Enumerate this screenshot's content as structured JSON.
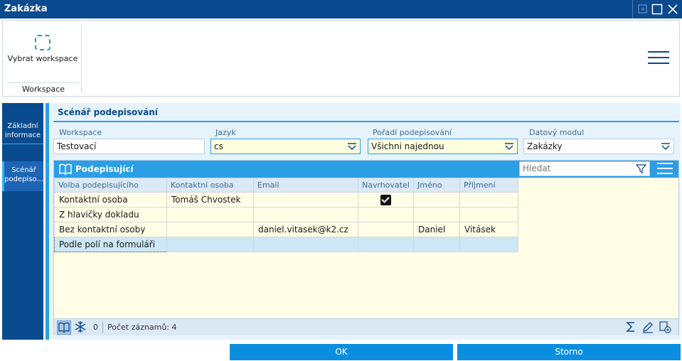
{
  "window": {
    "title": "Zakázka"
  },
  "ribbon": {
    "select_workspace_label": "Vybrat workspace",
    "group_label": "Workspace"
  },
  "left_tabs": [
    {
      "line1": "Základní",
      "line2": "informace"
    },
    {
      "line1": "Scénář",
      "line2": "podepiso..."
    }
  ],
  "section": {
    "title": "Scénář podepisování"
  },
  "fields": {
    "workspace": {
      "label": "Workspace",
      "value": "Testovací"
    },
    "jazyk": {
      "label": "Jazyk",
      "value": "cs"
    },
    "poradi": {
      "label": "Pořadí podepisování",
      "value": "Všichni najednou"
    },
    "datovy_modul": {
      "label": "Datový modul",
      "value": "Zakázky"
    }
  },
  "grid": {
    "title": "Podepisující",
    "search_placeholder": "Hledat",
    "columns": [
      "Volba podepisujícího",
      "Kontaktní osoba",
      "Email",
      "Navrhovatel",
      "Jméno",
      "Příjmení"
    ],
    "rows": [
      {
        "volba": "Kontaktní osoba",
        "kontakt": "Tomáš Chvostek",
        "email": "",
        "navrhovatel": true,
        "jmeno": "",
        "prijmeni": ""
      },
      {
        "volba": "Z hlavičky dokladu",
        "kontakt": "",
        "email": "",
        "navrhovatel": false,
        "jmeno": "",
        "prijmeni": ""
      },
      {
        "volba": "Bez kontaktní osoby",
        "kontakt": "",
        "email": "daniel.vitasek@k2.cz",
        "navrhovatel": false,
        "jmeno": "Daniel",
        "prijmeni": "Vitásek"
      },
      {
        "volba": "Podle polí na formuláři",
        "kontakt": "",
        "email": "",
        "navrhovatel": false,
        "jmeno": "",
        "prijmeni": ""
      }
    ],
    "footer": {
      "selected_count": "0",
      "records_label": "Počet záznamů: 4"
    }
  },
  "buttons": {
    "ok": "OK",
    "storno": "Storno"
  },
  "colors": {
    "titlebar": "#0a4a8f",
    "accent": "#2b9ee6",
    "grid_bg": "#fffde6",
    "selected_row": "#cce7f6"
  }
}
